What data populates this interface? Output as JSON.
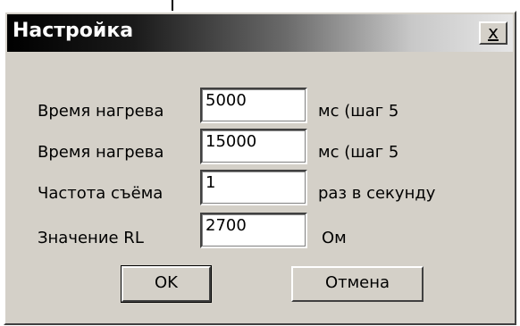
{
  "window": {
    "title": "Настройка",
    "close_label": "×"
  },
  "rows": [
    {
      "label": "Время нагрева",
      "value": "5000",
      "unit": "мс (шаг 5"
    },
    {
      "label": "Время нагрева",
      "value": "15000",
      "unit": "мс (шаг 5"
    },
    {
      "label": "Частота съёма",
      "value": "1",
      "unit": "раз в секунду"
    },
    {
      "label": "Значение RL",
      "value": "2700",
      "unit": "Ом"
    }
  ],
  "buttons": {
    "ok": "OK",
    "cancel": "Отмена"
  }
}
